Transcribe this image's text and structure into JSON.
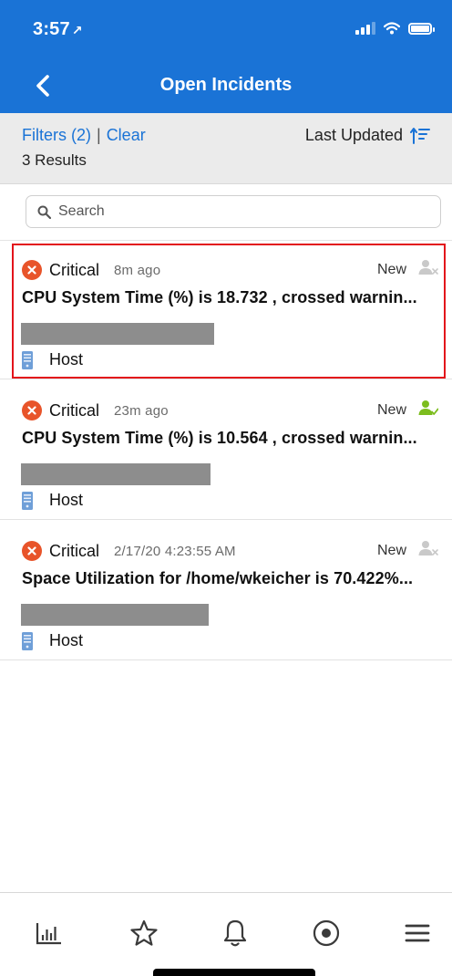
{
  "status_bar": {
    "time": "3:57",
    "location_glyph": "↗"
  },
  "nav": {
    "title": "Open Incidents",
    "back_icon": "chevron-left-icon"
  },
  "filter_bar": {
    "filters_label": "Filters (2)",
    "separator": "|",
    "clear_label": "Clear",
    "results_label": "3 Results",
    "sort_label": "Last Updated",
    "sort_icon": "sort-ascending-icon"
  },
  "search": {
    "placeholder": "Search"
  },
  "colors": {
    "header_bg": "#1a73d6",
    "link": "#1a73d6",
    "critical": "#e8542a",
    "assigned": "#7cbd1e",
    "unassigned": "#c9c9c9",
    "selection_border": "#e3141b"
  },
  "incidents": [
    {
      "severity": "Critical",
      "age": "8m ago",
      "status": "New",
      "assigned": false,
      "title": "CPU System Time (%) is 18.732 , crossed warnin...",
      "type": "Host",
      "selected": true
    },
    {
      "severity": "Critical",
      "age": "23m ago",
      "status": "New",
      "assigned": true,
      "title": "CPU System Time (%) is 10.564 , crossed warnin...",
      "type": "Host",
      "selected": false
    },
    {
      "severity": "Critical",
      "age": "2/17/20 4:23:55 AM",
      "status": "New",
      "assigned": false,
      "title": "Space Utilization for /home/wkeicher is 70.422%...",
      "type": "Host",
      "selected": false
    }
  ],
  "tabbar": {
    "items": [
      "bar-chart-icon",
      "star-icon",
      "bell-icon",
      "target-icon",
      "menu-icon"
    ]
  }
}
